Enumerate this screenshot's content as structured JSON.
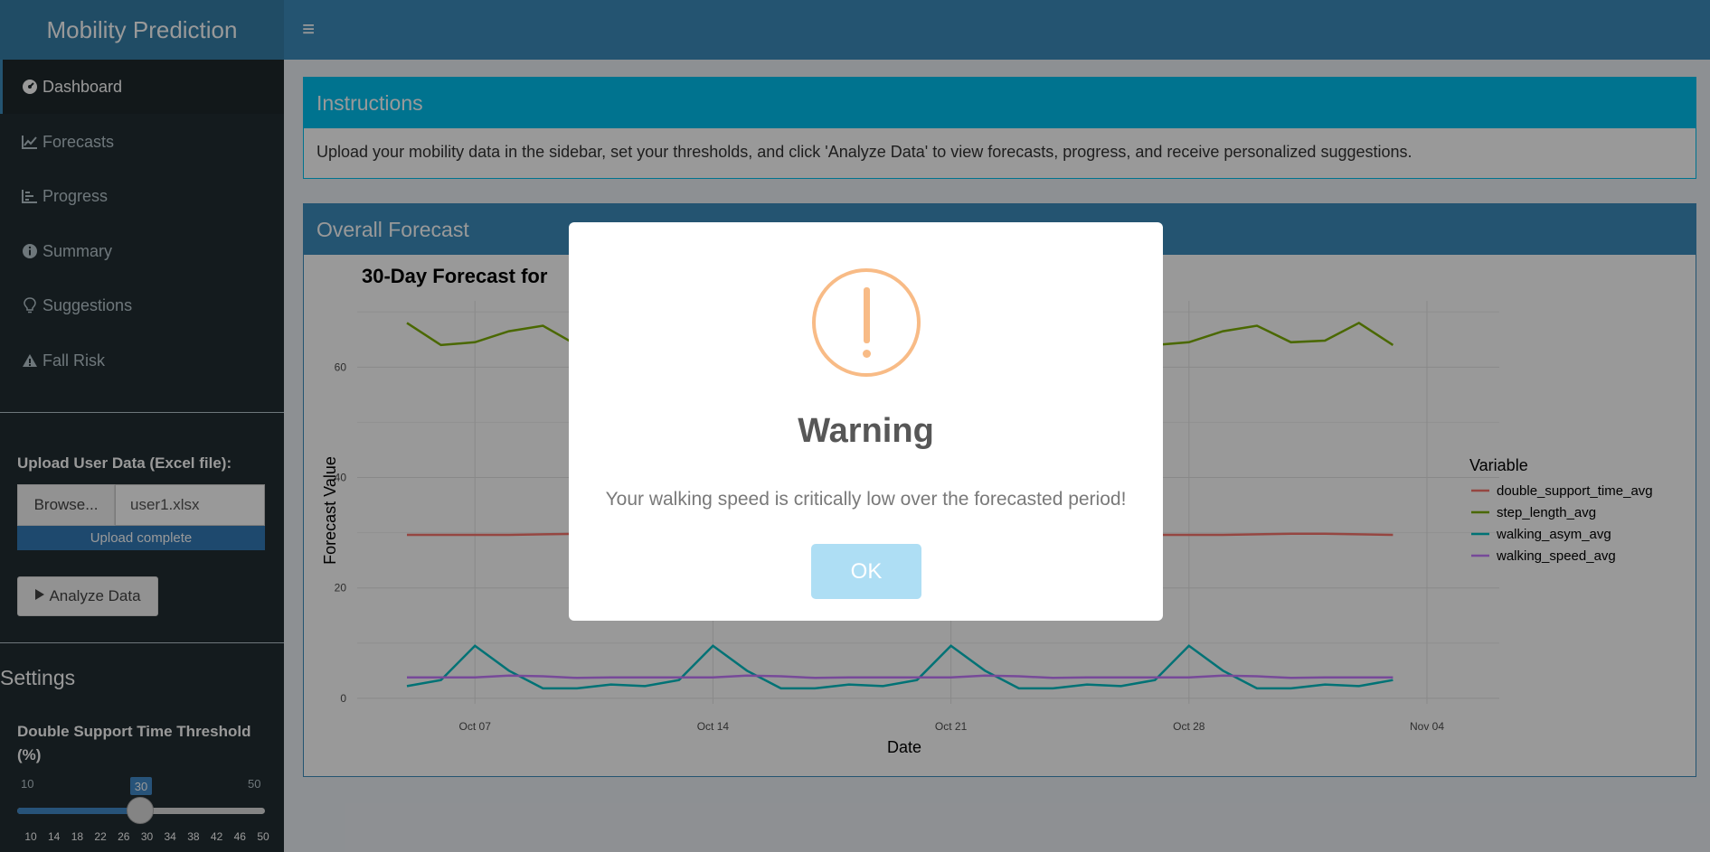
{
  "app": {
    "title": "Mobility Prediction",
    "toggle_icon": "≡"
  },
  "sidebar": {
    "items": [
      {
        "label": "Dashboard",
        "icon": "dashboard-icon"
      },
      {
        "label": "Forecasts",
        "icon": "line-chart-icon"
      },
      {
        "label": "Progress",
        "icon": "bar-chart-icon"
      },
      {
        "label": "Summary",
        "icon": "info-circle-icon"
      },
      {
        "label": "Suggestions",
        "icon": "lightbulb-icon"
      },
      {
        "label": "Fall Risk",
        "icon": "warning-triangle-icon"
      }
    ],
    "upload_label": "Upload User Data (Excel file):",
    "browse_label": "Browse...",
    "file_name": "user1.xlsx",
    "upload_status": "Upload complete",
    "analyze_label": "Analyze Data",
    "settings_title": "Settings",
    "slider": {
      "label": "Double Support Time Threshold (%)",
      "min": "10",
      "max": "50",
      "value": "30",
      "ticks": [
        "10",
        "14",
        "18",
        "22",
        "26",
        "30",
        "34",
        "38",
        "42",
        "46",
        "50"
      ]
    }
  },
  "instructions": {
    "title": "Instructions",
    "text": "Upload your mobility data in the sidebar, set your thresholds, and click 'Analyze Data' to view forecasts, progress, and receive personalized suggestions."
  },
  "forecast": {
    "title": "Overall Forecast"
  },
  "chart_data": {
    "type": "line",
    "title": "30-Day Forecast for",
    "xlabel": "Date",
    "ylabel": "Forecast Value",
    "x_ticks": [
      "Oct 07",
      "Oct 14",
      "Oct 21",
      "Oct 28",
      "Nov 04"
    ],
    "y_ticks": [
      "0",
      "20",
      "40",
      "60"
    ],
    "ylim": [
      -1,
      72
    ],
    "legend_title": "Variable",
    "legend_position": "right",
    "grid": true,
    "x": [
      "Oct 05",
      "Oct 06",
      "Oct 07",
      "Oct 08",
      "Oct 09",
      "Oct 10",
      "Oct 11",
      "Oct 12",
      "Oct 13",
      "Oct 14",
      "Oct 15",
      "Oct 16",
      "Oct 17",
      "Oct 18",
      "Oct 19",
      "Oct 20",
      "Oct 21",
      "Oct 22",
      "Oct 23",
      "Oct 24",
      "Oct 25",
      "Oct 26",
      "Oct 27",
      "Oct 28",
      "Oct 29",
      "Oct 30",
      "Oct 31",
      "Nov 01",
      "Nov 02",
      "Nov 03"
    ],
    "series": [
      {
        "name": "double_support_time_avg",
        "color": "#F8766D",
        "values": [
          29.6,
          29.6,
          29.6,
          29.6,
          29.7,
          29.8,
          29.8,
          29.7,
          29.6,
          29.6,
          29.6,
          29.6,
          29.6,
          29.7,
          29.8,
          29.8,
          29.7,
          29.6,
          29.6,
          29.6,
          29.6,
          29.6,
          29.6,
          29.6,
          29.6,
          29.7,
          29.8,
          29.8,
          29.7,
          29.6
        ]
      },
      {
        "name": "step_length_avg",
        "color": "#7CAE00",
        "values": [
          68,
          64,
          64.5,
          66.5,
          67.5,
          64,
          64.5,
          67,
          68,
          64,
          64.5,
          66.5,
          67.5,
          64,
          64.5,
          67,
          68,
          64,
          64.5,
          66.5,
          67.5,
          64,
          64,
          64.5,
          66.5,
          67.5,
          64.5,
          64.8,
          68,
          64
        ]
      },
      {
        "name": "walking_asym_avg",
        "color": "#00BFC4",
        "values": [
          2.2,
          3.3,
          9.5,
          5,
          1.8,
          1.8,
          2.5,
          2.2,
          3.3,
          9.5,
          5,
          1.8,
          1.8,
          2.5,
          2.2,
          3.3,
          9.5,
          5,
          1.8,
          1.8,
          2.5,
          2.2,
          3.3,
          9.5,
          5,
          1.8,
          1.8,
          2.5,
          2.2,
          3.3
        ]
      },
      {
        "name": "walking_speed_avg",
        "color": "#C77CFF",
        "values": [
          3.8,
          3.8,
          3.8,
          4.1,
          4.0,
          3.7,
          3.8,
          3.8,
          3.8,
          3.8,
          4.1,
          4.0,
          3.7,
          3.8,
          3.8,
          3.8,
          3.8,
          4.1,
          4.0,
          3.7,
          3.8,
          3.8,
          3.8,
          3.8,
          4.1,
          4.0,
          3.7,
          3.8,
          3.8,
          3.8
        ]
      }
    ]
  },
  "modal": {
    "title": "Warning",
    "text": "Your walking speed is critically low over the forecasted period!",
    "ok_label": "OK",
    "icon": "warning-exclamation-icon",
    "icon_color": "#f8bb86",
    "button_color": "#aedef4"
  },
  "colors": {
    "header": "#3c8dbc",
    "logo": "#367fa9",
    "sidebar": "#222d32",
    "info": "#00c0ef"
  }
}
